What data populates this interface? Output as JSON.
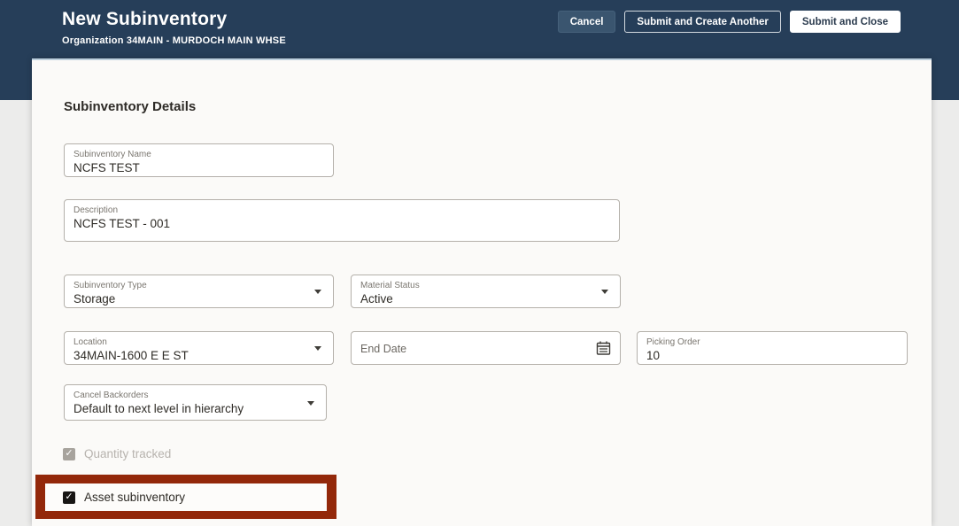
{
  "header": {
    "title": "New Subinventory",
    "subtitle": "Organization 34MAIN - MURDOCH MAIN WHSE",
    "buttons": {
      "cancel": "Cancel",
      "submit_create_another": "Submit and Create Another",
      "submit_close": "Submit and Close"
    }
  },
  "panel": {
    "section_title": "Subinventory Details",
    "fields": {
      "subinventory_name": {
        "label": "Subinventory Name",
        "value": "NCFS TEST"
      },
      "description": {
        "label": "Description",
        "value": "NCFS TEST - 001"
      },
      "subinventory_type": {
        "label": "Subinventory Type",
        "value": "Storage",
        "type": "dropdown"
      },
      "material_status": {
        "label": "Material Status",
        "value": "Active",
        "type": "dropdown"
      },
      "location": {
        "label": "Location",
        "value": "34MAIN-1600 E E ST",
        "type": "dropdown"
      },
      "end_date": {
        "label": "End Date",
        "value": "",
        "type": "date"
      },
      "picking_order": {
        "label": "Picking Order",
        "value": "10"
      },
      "cancel_backorders": {
        "label": "Cancel Backorders",
        "value": "Default to next level in hierarchy",
        "type": "dropdown"
      }
    },
    "checkboxes": {
      "quantity_tracked": {
        "label": "Quantity tracked",
        "checked": true,
        "disabled": true
      },
      "asset_subinventory": {
        "label": "Asset subinventory",
        "checked": true,
        "highlighted": true
      }
    }
  },
  "icons": {
    "checkmark": "✓"
  },
  "colors": {
    "header_navy": "#263e59",
    "annotation_red": "#93280a",
    "panel_bg": "#fbfaf8",
    "page_bg": "#ececeb",
    "field_border": "#b4b0aa",
    "text_dark": "#2f2c27",
    "label_gray": "#7a766f",
    "disabled_gray": "#b7b3ae"
  }
}
